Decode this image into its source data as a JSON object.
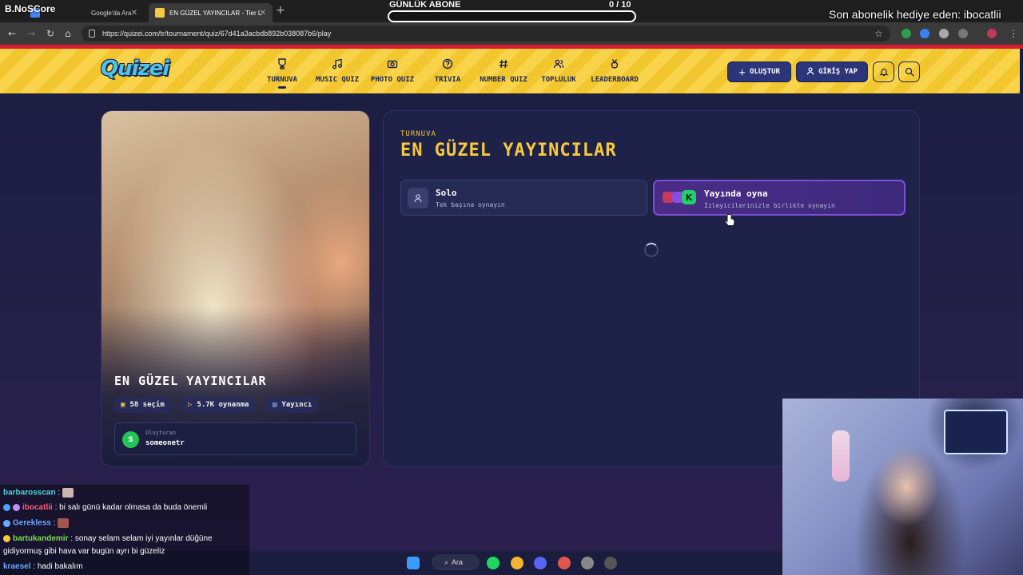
{
  "browser": {
    "tabs": [
      {
        "label": "Google'da Ara"
      },
      {
        "label": "EN GÜZEL YAYINCILAR - Tier Li..."
      }
    ],
    "url": "https://quizei.com/tr/tournament/quiz/67d41a3acbdb892b038087b6/play"
  },
  "overlay": {
    "channel_logo": "B.NoSCore",
    "sub_goal_label": "GÜNLÜK ABONE",
    "sub_goal_count": "0 / 10",
    "sub_goal_progress": 0.0,
    "gift_message": "Son abonelik hediye eden: ibocatlii"
  },
  "site": {
    "logo": "Quizei",
    "nav": [
      {
        "label": "TURNUVA",
        "icon": "trophy-icon",
        "active": true
      },
      {
        "label": "MUSIC QUIZ",
        "icon": "music-icon",
        "active": false
      },
      {
        "label": "PHOTO QUIZ",
        "icon": "camera-icon",
        "active": false
      },
      {
        "label": "TRIVIA",
        "icon": "question-icon",
        "active": false
      },
      {
        "label": "NUMBER QUIZ",
        "icon": "hash-icon",
        "active": false
      },
      {
        "label": "TOPLULUK",
        "icon": "people-icon",
        "active": false
      },
      {
        "label": "LEADERBOARD",
        "icon": "medal-icon",
        "active": false
      }
    ],
    "create_button": "OLUŞTUR",
    "login_button": "GİRİŞ YAP"
  },
  "quiz": {
    "title": "EN GÜZEL YAYINCILAR",
    "kicker": "TURNUVA",
    "stats": {
      "choices": "58 seçim",
      "plays": "5.7K oynanma",
      "category": "Yayıncı"
    },
    "creator_label": "Oluşturan",
    "creator_name": "someonetr",
    "creator_initial": "S"
  },
  "modes": {
    "solo": {
      "title": "Solo",
      "subtitle": "Tek başına oynayın"
    },
    "stream": {
      "title": "Yayında oyna",
      "subtitle": "İzleyicilerinizle birlikte oynayın"
    }
  },
  "chat": [
    {
      "user": "barbarosscan",
      "color": "#4fd1d9",
      "message": ""
    },
    {
      "user": "ibocatlii",
      "color": "#ff5a7a",
      "message": "bi salı günü kadar olmasa da buda önemli"
    },
    {
      "user": "Gerekless",
      "color": "#6aa8ff",
      "message": ""
    },
    {
      "user": "bartukandemir",
      "color": "#7ed957",
      "message": "sonay selam selam iyi yayınlar düğüne"
    },
    {
      "user": "",
      "color": "#ffffff",
      "message": "gidiyormuş gibi hava var bugün ayrı bi güzeliz"
    },
    {
      "user": "kraesel",
      "color": "#6aa8ff",
      "message": "hadi bakalım"
    }
  ],
  "taskbar": {
    "search_label": "Ara"
  }
}
